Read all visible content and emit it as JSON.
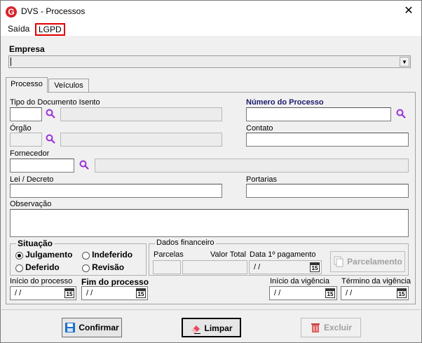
{
  "window": {
    "title": "DVS - Processos",
    "close_glyph": "✕",
    "app_icon_letter": "G"
  },
  "menu": {
    "saida": "Saída",
    "lgpd": "LGPD"
  },
  "empresa": {
    "label": "Empresa",
    "value": ""
  },
  "tabs": [
    {
      "label": "Processo"
    },
    {
      "label": "Veículos"
    }
  ],
  "form": {
    "tipo_documento": {
      "label": "Tipo do Documento Isento",
      "code": "",
      "desc": ""
    },
    "numero_processo": {
      "label": "Número do Processo",
      "value": ""
    },
    "orgao": {
      "label": "Órgão",
      "code": "",
      "desc": ""
    },
    "contato": {
      "label": "Contato",
      "value": ""
    },
    "fornecedor": {
      "label": "Fornecedor",
      "code": "",
      "desc": ""
    },
    "lei_decreto": {
      "label": "Lei / Decreto",
      "value": ""
    },
    "portarias": {
      "label": "Portarias",
      "value": ""
    },
    "observacao": {
      "label": "Observação",
      "value": ""
    }
  },
  "situacao": {
    "legend": "Situação",
    "options": [
      {
        "label": "Julgamento",
        "selected": true
      },
      {
        "label": "Indeferido",
        "selected": false
      },
      {
        "label": "Deferido",
        "selected": false
      },
      {
        "label": "Revisão",
        "selected": false
      }
    ]
  },
  "dados_financeiro": {
    "legend": "Dados financeiro",
    "parcelas_label": "Parcelas",
    "valor_total_label": "Valor Total",
    "data_pagamento_label": "Data 1º pagamento",
    "data_pagamento_value": "/ /",
    "parcelamento_button": "Parcelamento"
  },
  "datas": {
    "inicio_processo": {
      "label": "Início do processo",
      "value": "/ /"
    },
    "fim_processo": {
      "label": "Fim do processo",
      "value": "/ /"
    },
    "inicio_vigencia": {
      "label": "Início da vigência",
      "value": "/ /"
    },
    "termino_vigencia": {
      "label": "Término da vigência",
      "value": "/ /"
    }
  },
  "calendar_day": "15",
  "buttons": {
    "confirmar": "Confirmar",
    "limpar": "Limpar",
    "excluir": "Excluir"
  },
  "colors": {
    "accent_label": "#1a1a6e",
    "search_icon": "#9b30d9",
    "highlight": "#e00000"
  }
}
